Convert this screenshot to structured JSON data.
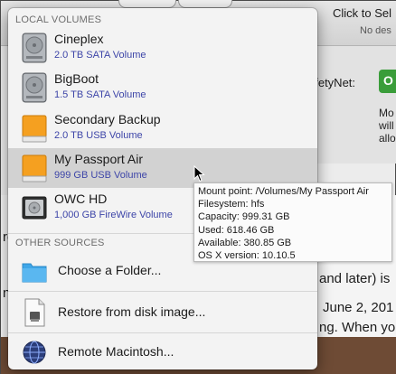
{
  "background_window": {
    "click_label": "Click to Sel",
    "no_destination": "No des",
    "safetynet_label": "afetyNet:",
    "toggle_text": "O",
    "side_text": [
      "Mo",
      "will",
      "allo"
    ],
    "doc_lines": [
      "and later) is",
      "June 2, 201",
      "ng. When yo"
    ],
    "doc_left_fragments": [
      "ro",
      "ng"
    ]
  },
  "popup": {
    "local_header": "LOCAL VOLUMES",
    "other_header": "OTHER SOURCES",
    "volumes": [
      {
        "name": "Cineplex",
        "detail": "2.0 TB SATA Volume",
        "icon": "internal-hard-drive-icon"
      },
      {
        "name": "BigBoot",
        "detail": "1.5 TB SATA Volume",
        "icon": "internal-hard-drive-icon"
      },
      {
        "name": "Secondary Backup",
        "detail": "2.0 TB USB Volume",
        "icon": "external-usb-drive-icon"
      },
      {
        "name": "My Passport Air",
        "detail": "999 GB USB Volume",
        "icon": "external-usb-drive-icon"
      },
      {
        "name": "OWC HD",
        "detail": "1,000 GB FireWire Volume",
        "icon": "firewire-drive-icon"
      }
    ],
    "sources": [
      {
        "label": "Choose a Folder...",
        "icon": "folder-icon"
      },
      {
        "label": "Restore from disk image...",
        "icon": "disk-image-icon"
      },
      {
        "label": "Remote Macintosh...",
        "icon": "network-globe-icon"
      }
    ]
  },
  "tooltip": {
    "lines": [
      "Mount point: /Volumes/My Passport Air",
      "Filesystem: hfs",
      "Capacity: 999.31 GB",
      "Used: 618.46 GB",
      "Available: 380.85 GB",
      "OS X version: 10.10.5"
    ]
  },
  "colors": {
    "menu_background": "#f3f3f3",
    "highlight": "#d2d2d2",
    "volume_detail_text": "#3d45a8",
    "usb_drive_orange": "#f5a020",
    "folder_blue": "#3ea6e8"
  }
}
